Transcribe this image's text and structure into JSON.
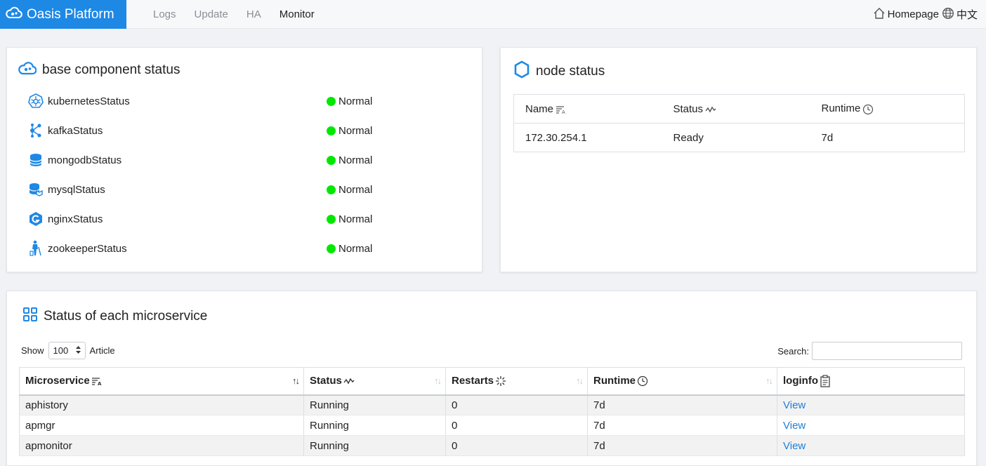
{
  "header": {
    "brand": "Oasis Platform",
    "nav": [
      {
        "label": "Logs",
        "active": false
      },
      {
        "label": "Update",
        "active": false
      },
      {
        "label": "HA",
        "active": false
      },
      {
        "label": "Monitor",
        "active": true
      }
    ],
    "homepage": "Homepage",
    "language": "中文"
  },
  "base_components": {
    "title": "base component status",
    "items": [
      {
        "name": "kubernetesStatus",
        "status": "Normal",
        "icon": "kubernetes-icon"
      },
      {
        "name": "kafkaStatus",
        "status": "Normal",
        "icon": "kafka-icon"
      },
      {
        "name": "mongodbStatus",
        "status": "Normal",
        "icon": "mongodb-icon"
      },
      {
        "name": "mysqlStatus",
        "status": "Normal",
        "icon": "mysql-icon"
      },
      {
        "name": "nginxStatus",
        "status": "Normal",
        "icon": "nginx-icon"
      },
      {
        "name": "zookeeperStatus",
        "status": "Normal",
        "icon": "zookeeper-icon"
      }
    ],
    "status_color": "#00e800"
  },
  "node_status": {
    "title": "node status",
    "columns": [
      "Name",
      "Status",
      "Runtime"
    ],
    "rows": [
      [
        "172.30.254.1",
        "Ready",
        "7d"
      ]
    ]
  },
  "microservices": {
    "title": "Status of each microservice",
    "show_label": "Show",
    "page_size": "100",
    "article_label": "Article",
    "search_label": "Search:",
    "search_value": "",
    "columns": [
      "Microservice",
      "Status",
      "Restarts",
      "Runtime",
      "loginfo"
    ],
    "rows": [
      {
        "name": "aphistory",
        "status": "Running",
        "restarts": "0",
        "runtime": "7d",
        "log": "View"
      },
      {
        "name": "apmgr",
        "status": "Running",
        "restarts": "0",
        "runtime": "7d",
        "log": "View"
      },
      {
        "name": "apmonitor",
        "status": "Running",
        "restarts": "0",
        "runtime": "7d",
        "log": "View"
      }
    ]
  },
  "colors": {
    "brand": "#1e88e5",
    "link": "#1e7fd6",
    "normal": "#00e800"
  }
}
